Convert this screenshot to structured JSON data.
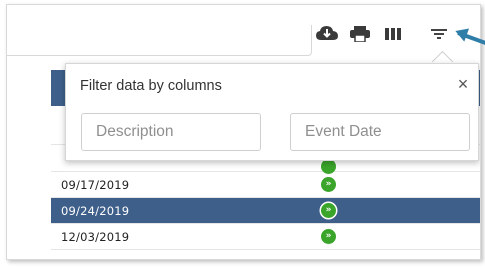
{
  "toolbar": {
    "icons": [
      "cloud-download-icon",
      "print-icon",
      "columns-icon",
      "filter-icon"
    ]
  },
  "filter_popup": {
    "title": "Filter data by columns",
    "close_label": "×",
    "description_placeholder": "Description",
    "event_date_placeholder": "Event Date"
  },
  "table": {
    "rows": [
      {
        "date": "09/17/2019",
        "action": "»",
        "selected": false
      },
      {
        "date": "09/24/2019",
        "action": "»",
        "selected": true
      },
      {
        "date": "12/03/2019",
        "action": "»",
        "selected": false
      }
    ]
  },
  "colors": {
    "header": "#3e5f8a",
    "selected_row": "#3e5f8a",
    "go_button": "#3aa52a",
    "annotation_arrow": "#2e7ea8"
  }
}
